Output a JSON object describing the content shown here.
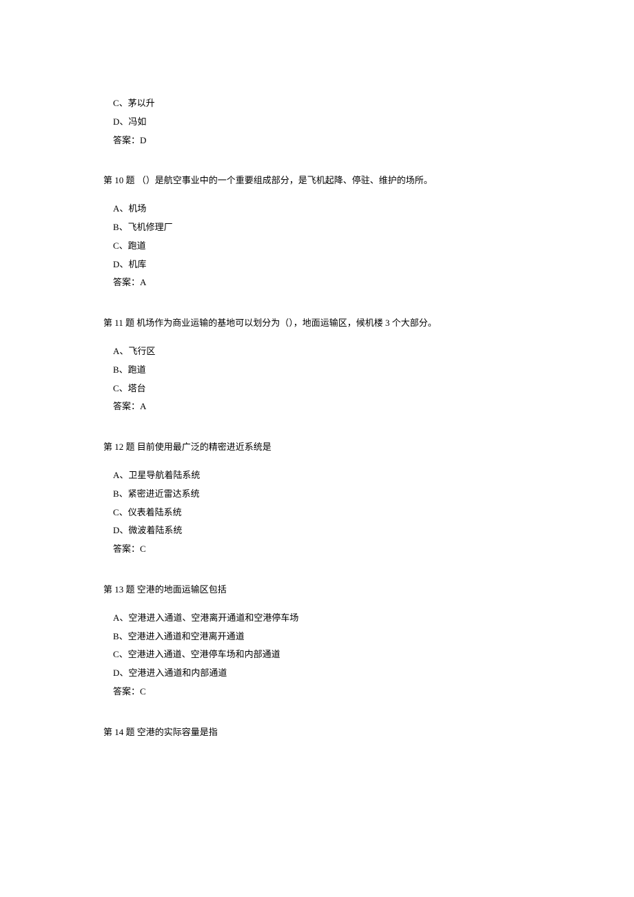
{
  "q9_remaining": {
    "options": [
      {
        "label": "C、茅以升"
      },
      {
        "label": "D、冯如"
      }
    ],
    "answer": "答案：D"
  },
  "q10": {
    "title": "第 10 题  （）是航空事业中的一个重要组成部分，是飞机起降、停驻、维护的场所。",
    "options": [
      {
        "label": "A、机场"
      },
      {
        "label": "B、飞机修理厂"
      },
      {
        "label": "C、跑道"
      },
      {
        "label": "D、机库"
      }
    ],
    "answer": "答案：A"
  },
  "q11": {
    "title": "第 11 题  机场作为商业运输的基地可以划分为（），地面运输区，候机楼 3 个大部分。",
    "options": [
      {
        "label": "A、飞行区"
      },
      {
        "label": "B、跑道"
      },
      {
        "label": "C、塔台"
      }
    ],
    "answer": "答案：A"
  },
  "q12": {
    "title": "第 12 题  目前使用最广泛的精密进近系统是",
    "options": [
      {
        "label": "A、卫星导航着陆系统"
      },
      {
        "label": "B、紧密进近雷达系统"
      },
      {
        "label": "C、仪表着陆系统"
      },
      {
        "label": "D、微波着陆系统"
      }
    ],
    "answer": "答案：C"
  },
  "q13": {
    "title": "第 13 题  空港的地面运输区包括",
    "options": [
      {
        "label": "A、空港进入通道、空港离开通道和空港停车场"
      },
      {
        "label": "B、空港进入通道和空港离开通道"
      },
      {
        "label": "C、空港进入通道、空港停车场和内部通道"
      },
      {
        "label": "D、空港进入通道和内部通道"
      }
    ],
    "answer": "答案：C"
  },
  "q14": {
    "title": "第 14 题  空港的实际容量是指"
  }
}
